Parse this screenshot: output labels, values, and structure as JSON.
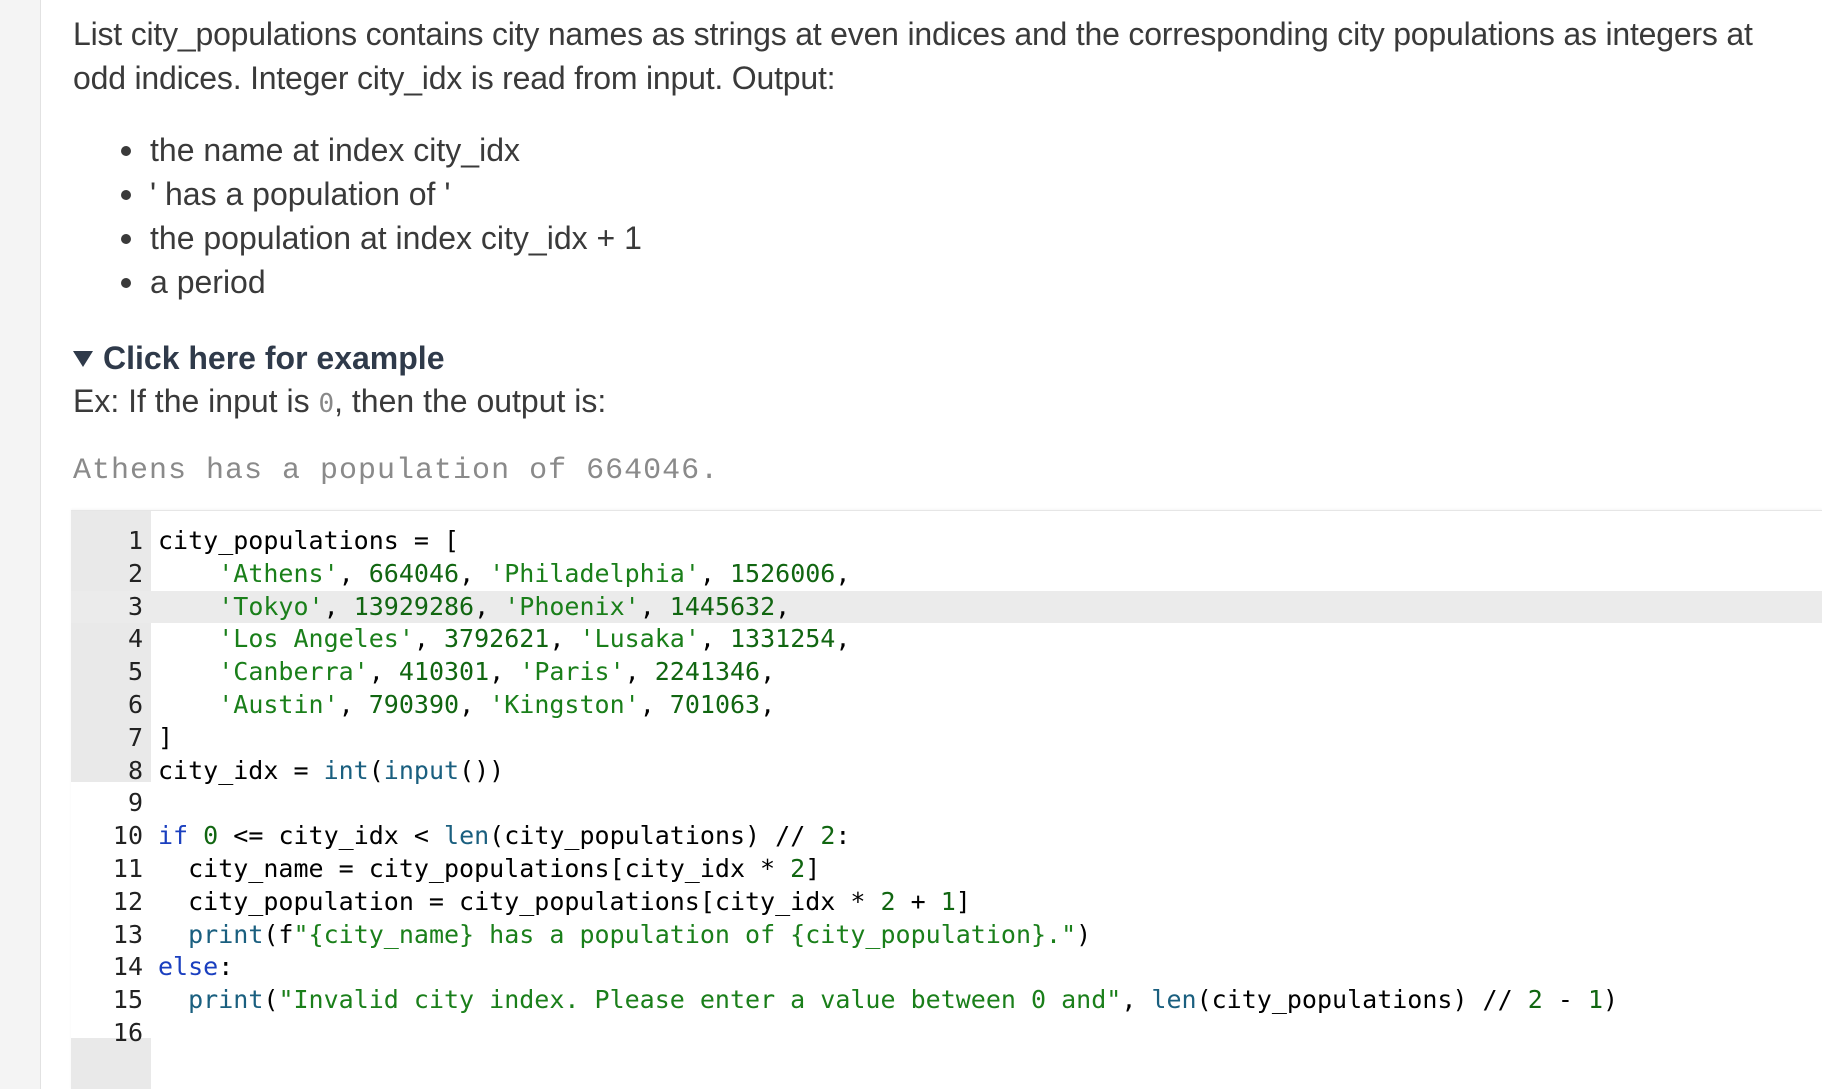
{
  "prompt": {
    "text": "List city_populations contains city names as strings at even indices and the corresponding city populations as integers at odd indices. Integer city_idx is read from input. Output:"
  },
  "bullets": [
    "the name at index city_idx",
    "' has a population of '",
    "the population at index city_idx + 1",
    "a period"
  ],
  "example": {
    "toggle_label": "Click here for example",
    "intro_before": "Ex: If the input is ",
    "intro_input": "0",
    "intro_after": ", then the output is:",
    "output": "Athens has a population of 664046."
  },
  "editor": {
    "active_line": 3,
    "line_numbers": [
      "1",
      "2",
      "3",
      "4",
      "5",
      "6",
      "7",
      "8",
      "9",
      "10",
      "11",
      "12",
      "13",
      "14",
      "15",
      "16"
    ],
    "lines": [
      "city_populations = [",
      "    'Athens', 664046, 'Philadelphia', 1526006,",
      "    'Tokyo', 13929286, 'Phoenix', 1445632,",
      "    'Los Angeles', 3792621, 'Lusaka', 1331254,",
      "    'Canberra', 410301, 'Paris', 2241346,",
      "    'Austin', 790390, 'Kingston', 701063,",
      "]",
      "city_idx = int(input())",
      "",
      "if 0 <= city_idx < len(city_populations) // 2:",
      "  city_name = city_populations[city_idx * 2]",
      "  city_population = city_populations[city_idx * 2 + 1]",
      "  print(f\"{city_name} has a population of {city_population}.\")",
      "else:",
      "  print(\"Invalid city index. Please enter a value between 0 and\", len(city_populations) // 2 - 1)",
      ""
    ]
  },
  "colors": {
    "string": "#1a7f1a",
    "keyword": "#1a3fbf",
    "builtin": "#1a5f7f",
    "gutter": "#e9e9e9",
    "active_line": "#ebebeb"
  }
}
